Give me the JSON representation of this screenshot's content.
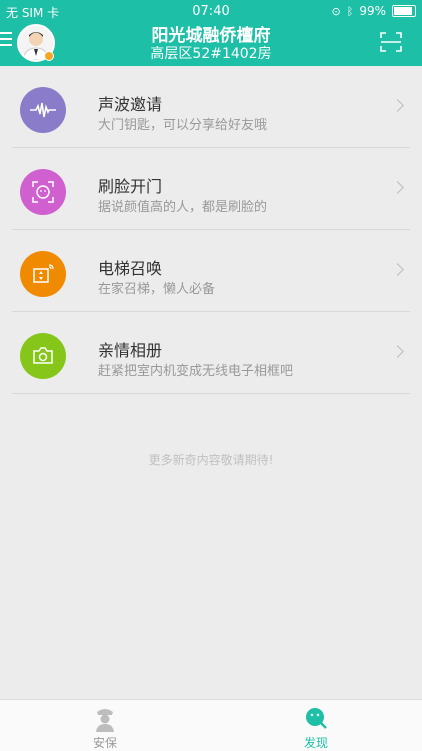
{
  "status": {
    "carrier": "无 SIM 卡",
    "time": "07:40",
    "battery": "99%"
  },
  "header": {
    "title": "阳光城融侨檀府",
    "subtitle": "高层区52#1402房"
  },
  "items": [
    {
      "title": "声波邀请",
      "desc": "大门钥匙，可以分享给好友哦",
      "color": "#8a7cc9",
      "icon": "soundwave-icon"
    },
    {
      "title": "刷脸开门",
      "desc": "据说颜值高的人，都是刷脸的",
      "color": "#d05fcf",
      "icon": "face-scan-icon"
    },
    {
      "title": "电梯召唤",
      "desc": "在家召梯，懒人必备",
      "color": "#f08a00",
      "icon": "elevator-icon"
    },
    {
      "title": "亲情相册",
      "desc": "赶紧把室内机变成无线电子相框吧",
      "color": "#86c61a",
      "icon": "camera-icon"
    }
  ],
  "more_text": "更多新奇内容敬请期待!",
  "tabs": [
    {
      "label": "安保",
      "active": false
    },
    {
      "label": "发现",
      "active": true
    }
  ],
  "colors": {
    "brand": "#1dbfa6"
  }
}
